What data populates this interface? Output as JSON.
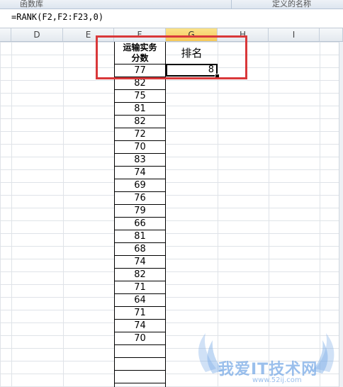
{
  "ribbon": {
    "left_group_label": "函数库",
    "right_group_label": "定义的名称"
  },
  "formula_bar": {
    "formula": "=RANK(F2,F2:F23,0)"
  },
  "columns": [
    "D",
    "E",
    "F",
    "G",
    "H",
    "I"
  ],
  "selected_column": "G",
  "sheet": {
    "f_header_line1": "运输实务",
    "f_header_line2": "分数",
    "g_header": "排名",
    "g_value": "8",
    "f_values": [
      "77",
      "82",
      "75",
      "81",
      "82",
      "72",
      "70",
      "83",
      "74",
      "69",
      "76",
      "79",
      "66",
      "81",
      "68",
      "74",
      "82",
      "71",
      "64",
      "71",
      "74",
      "70"
    ]
  },
  "watermark": {
    "text": "我爱IT技术网",
    "url": "www.52ij.com"
  },
  "colors": {
    "highlight_box": "#d9383a",
    "selected_header": "#f5c85a",
    "watermark": "#78aae6"
  }
}
